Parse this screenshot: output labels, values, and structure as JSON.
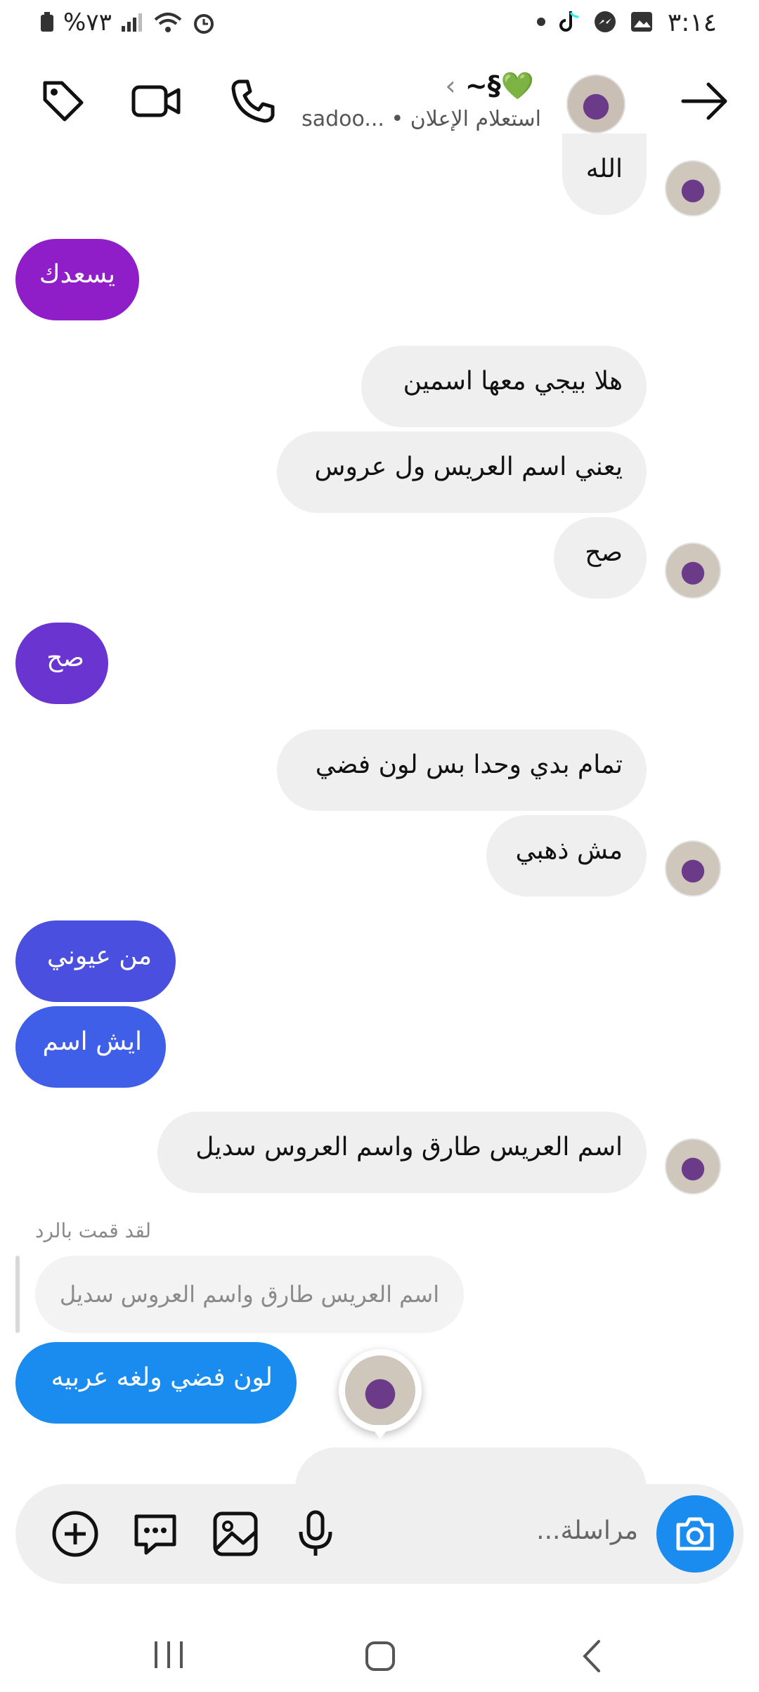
{
  "status": {
    "time": "٣:١٤",
    "battery": "%٧٣"
  },
  "header": {
    "title": "~§💚",
    "subtitle": "sadoo... • استعلام الإعلان"
  },
  "messages": [
    {
      "text": "الله",
      "side": "in"
    },
    {
      "text": "يسعدك",
      "side": "out",
      "color": "#8f1ec9"
    },
    {
      "text": "هلا بيجي معها اسمين",
      "side": "in"
    },
    {
      "text": "يعني اسم العريس ول عروس",
      "side": "in"
    },
    {
      "text": "صح",
      "side": "in"
    },
    {
      "text": "صح",
      "side": "out",
      "color": "#6a34d1"
    },
    {
      "text": "تمام بدي وحدا بس لون فضي",
      "side": "in"
    },
    {
      "text": "مش ذهبي",
      "side": "in"
    },
    {
      "text": "من عيوني",
      "side": "out",
      "color": "#4b4fe0"
    },
    {
      "text": "ايش اسم",
      "side": "out",
      "color": "#3f5fe8"
    },
    {
      "text": "اسم العريس طارق واسم العروس سديل",
      "side": "in"
    },
    {
      "text": "لون فضي ولغه عربيه",
      "side": "out",
      "color": "#1a8cf0"
    }
  ],
  "reply": {
    "label": "لقد قمت بالرد",
    "quoted": "اسم العريس طارق واسم العروس سديل"
  },
  "composer": {
    "placeholder": "مراسلة..."
  },
  "icons": [
    "tag-icon",
    "video-icon",
    "phone-icon",
    "back-arrow-icon",
    "add-icon",
    "sticker-icon",
    "gallery-icon",
    "mic-icon",
    "camera-icon"
  ]
}
